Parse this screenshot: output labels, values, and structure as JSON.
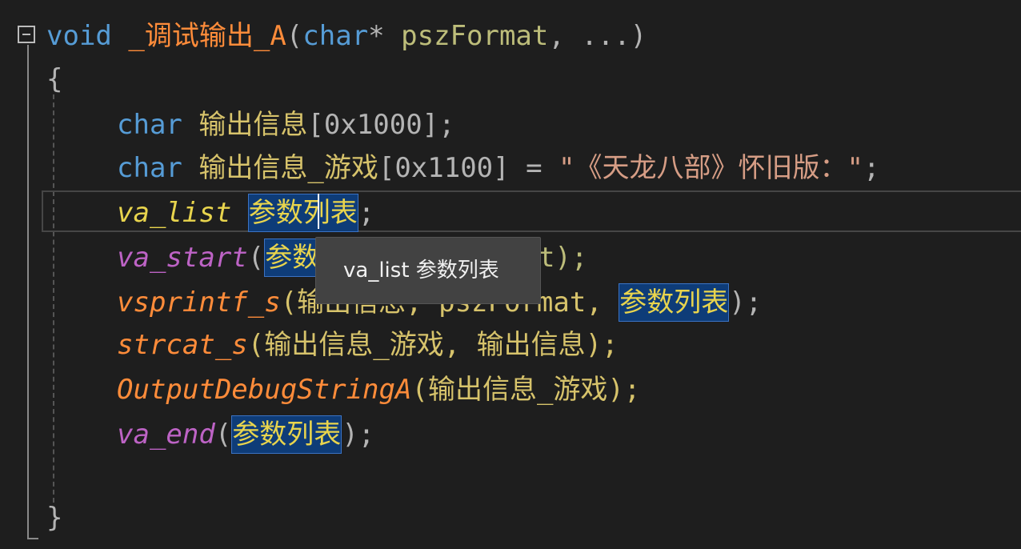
{
  "code": {
    "line1": {
      "keyword": "void",
      "function_name": "_调试输出_A",
      "open_paren": "(",
      "param_type": "char",
      "star": "*",
      "param_name": "pszFormat",
      "rest": ", ...)"
    },
    "line2": {
      "text": "{"
    },
    "line3": {
      "keyword": "char",
      "variable": "输出信息",
      "rest": "[0x1000];"
    },
    "line4": {
      "keyword": "char",
      "variable": "输出信息_游戏",
      "mid": "[0x1100] = ",
      "string": "\"《天龙八部》怀旧版：\"",
      "end": ";"
    },
    "line5": {
      "type": "va_list",
      "highlighted_var": "参数列表",
      "end": ";"
    },
    "line6": {
      "macro": "va_start",
      "open": "(",
      "highlighted_var": "参数列表",
      "rest": ", pszFormat);"
    },
    "line7": {
      "function": "vsprintf_s",
      "args": "(输出信息, pszFormat, ",
      "highlighted_var": "参数列表",
      "end": ");"
    },
    "line8": {
      "function": "strcat_s",
      "args": "(输出信息_游戏, 输出信息);"
    },
    "line9": {
      "function": "OutputDebugStringA",
      "args": "(输出信息_游戏);"
    },
    "line10": {
      "macro": "va_end",
      "open": "(",
      "highlighted_var": "参数列表",
      "end": ");"
    },
    "line11": {
      "text": "}"
    }
  },
  "tooltip": {
    "text": "va_list 参数列表"
  },
  "colors": {
    "background": "#1e1e1e",
    "keyword": "#569cd6",
    "function": "#ff8c3a",
    "variable": "#d7c36b",
    "string": "#d69d85",
    "type": "#e8d44d",
    "macro": "#bd63c5",
    "highlight": "#0e3c78",
    "tooltip_bg": "#424242"
  },
  "icons": {
    "fold": "collapse-minus-icon"
  }
}
